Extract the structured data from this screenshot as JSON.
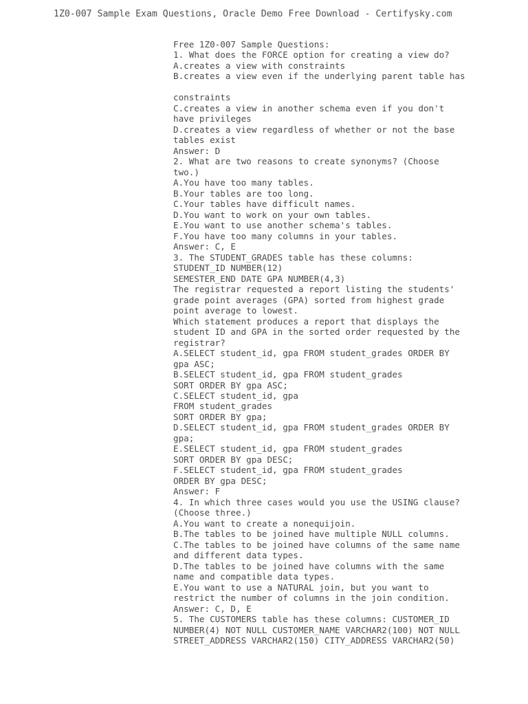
{
  "document": {
    "title": "1Z0-007 Sample Exam Questions, Oracle Demo Free Download - Certifysky.com",
    "header_text": "1Z0-007 Sample Exam Questions, Oracle Demo Free Download - Certifysky.com",
    "page_background": "#ffffff",
    "text_color": "#4a4a4a",
    "body_lines": [
      "Free 1Z0-007 Sample Questions:",
      "1. What does the FORCE option for creating a view do?",
      "A.creates a view with constraints",
      "B.creates a view even if the underlying parent table has",
      "",
      "constraints",
      "C.creates a view in another schema even if you don't",
      "have privileges",
      "D.creates a view regardless of whether or not the base",
      "tables exist",
      "Answer: D",
      "2. What are two reasons to create synonyms? (Choose",
      "two.)",
      "A.You have too many tables.",
      "B.Your tables are too long.",
      "C.Your tables have difficult names.",
      "D.You want to work on your own tables.",
      "E.You want to use another schema's tables.",
      "F.You have too many columns in your tables.",
      "Answer: C, E",
      "3. The STUDENT_GRADES table has these columns:",
      "STUDENT_ID NUMBER(12)",
      "SEMESTER_END DATE GPA NUMBER(4,3)",
      "The registrar requested a report listing the students'",
      "grade point averages (GPA) sorted from highest grade",
      "point average to lowest.",
      "Which statement produces a report that displays the",
      "student ID and GPA in the sorted order requested by the",
      "registrar?",
      "A.SELECT student_id, gpa FROM student_grades ORDER BY",
      "gpa ASC;",
      "B.SELECT student_id, gpa FROM student_grades",
      "SORT ORDER BY gpa ASC;",
      "C.SELECT student_id, gpa",
      "FROM student_grades",
      "SORT ORDER BY gpa;",
      "D.SELECT student_id, gpa FROM student_grades ORDER BY",
      "gpa;",
      "E.SELECT student_id, gpa FROM student_grades",
      "SORT ORDER BY gpa DESC;",
      "F.SELECT student_id, gpa FROM student_grades",
      "ORDER BY gpa DESC;",
      "Answer: F",
      "4. In which three cases would you use the USING clause?",
      "(Choose three.)",
      "A.You want to create a nonequijoin.",
      "B.The tables to be joined have multiple NULL columns.",
      "C.The tables to be joined have columns of the same name",
      "and different data types.",
      "D.The tables to be joined have columns with the same",
      "name and compatible data types.",
      "E.You want to use a NATURAL join, but you want to",
      "restrict the number of columns in the join condition.",
      "Answer: C, D, E",
      "5. The CUSTOMERS table has these columns: CUSTOMER_ID",
      "NUMBER(4) NOT NULL CUSTOMER_NAME VARCHAR2(100) NOT NULL",
      "STREET_ADDRESS VARCHAR2(150) CITY_ADDRESS VARCHAR2(50)"
    ]
  }
}
